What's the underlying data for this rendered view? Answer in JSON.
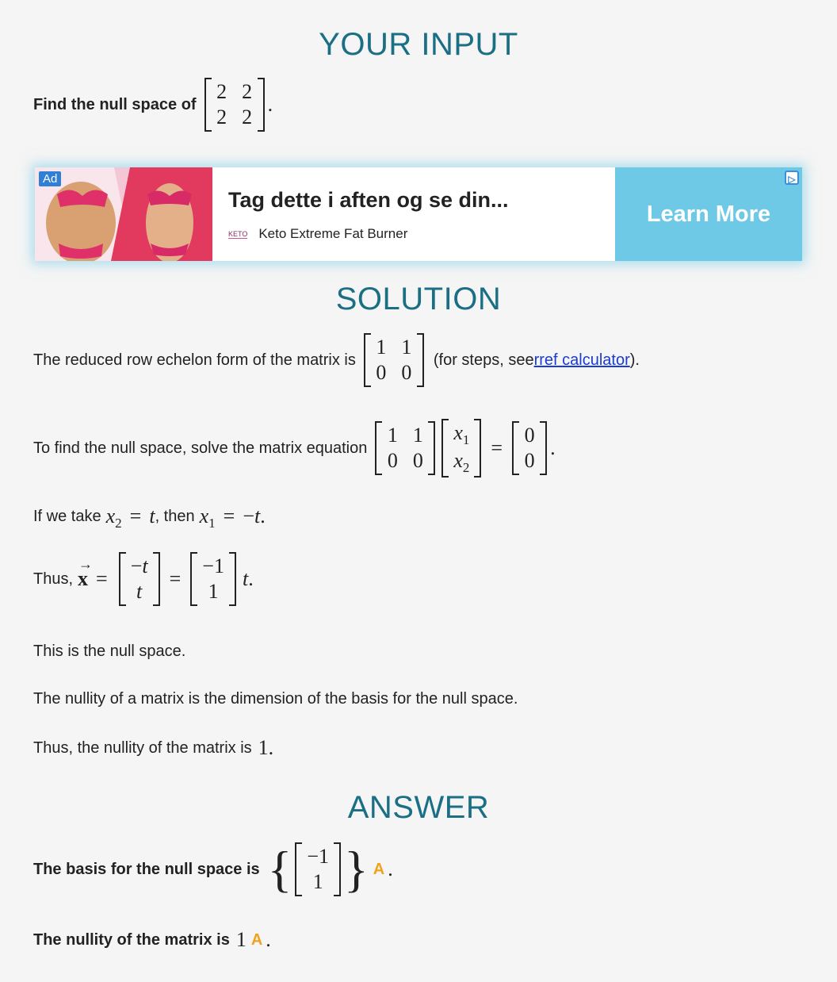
{
  "input": {
    "heading": "YOUR INPUT",
    "prompt": "Find the null space of",
    "matrix": [
      [
        "2",
        "2"
      ],
      [
        "2",
        "2"
      ]
    ],
    "end": "."
  },
  "ad": {
    "badge": "Ad",
    "title": "Tag dette i aften og se din...",
    "logo": "KETO",
    "brand": "Keto Extreme Fat Burner",
    "cta": "Learn More",
    "choice_icon": "adchoices-icon"
  },
  "solution": {
    "heading": "SOLUTION",
    "rref_text": "The reduced row echelon form of the matrix is",
    "rref_matrix": [
      [
        "1",
        "1"
      ],
      [
        "0",
        "0"
      ]
    ],
    "rref_note_pre": "(for steps, see ",
    "rref_link": "rref calculator",
    "rref_note_post": ").",
    "eq_text": "To find the null space, solve the matrix equation",
    "eq_end": ".",
    "take_pre": "If we take",
    "take_mid": ", then",
    "take_end": ".",
    "thus_text": "Thus,",
    "null_text": "This is the null space.",
    "nullity_def": "The nullity of a matrix is the dimension of the basis for the null space.",
    "nullity_text": "Thus, the nullity of the matrix is",
    "nullity_value": "1",
    "nullity_end": "."
  },
  "answer": {
    "heading": "ANSWER",
    "basis_text": "The basis for the null space is",
    "nullity_text": "The nullity of the matrix is",
    "nullity_value": "1",
    "tag": "A",
    "end": "."
  }
}
